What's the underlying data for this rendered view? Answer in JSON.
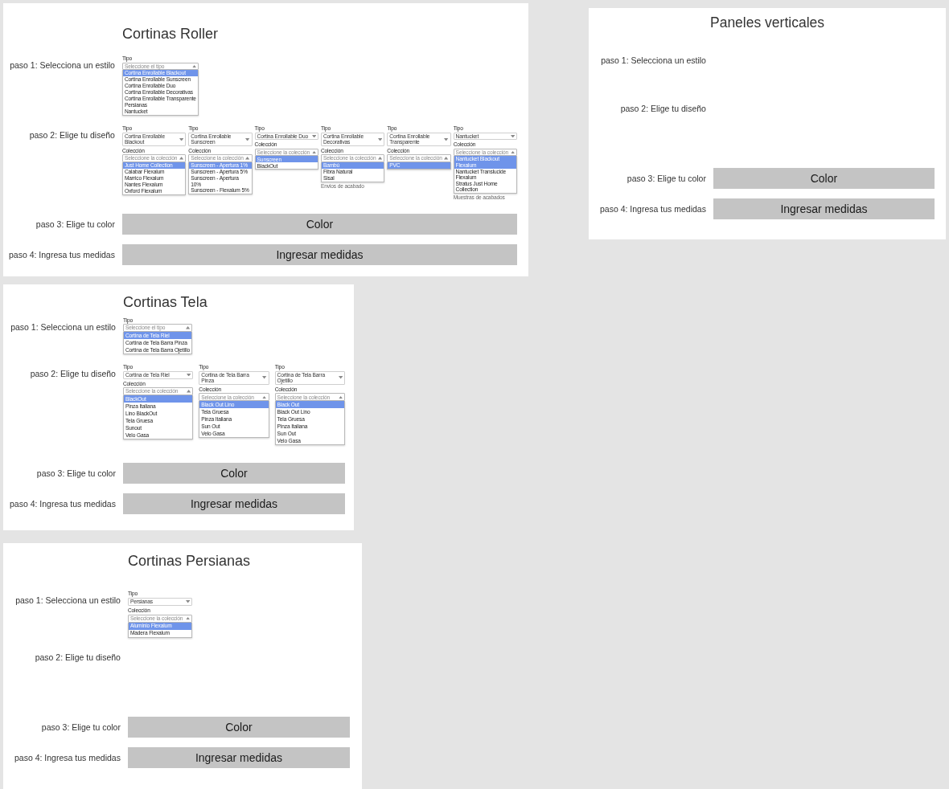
{
  "panels": [
    {
      "title": "Cortinas Roller",
      "steps": [
        {
          "kind": "style",
          "label": "paso 1: Selecciona un estilo",
          "forms": [
            {
              "fields": [
                {
                  "kind": "open",
                  "label": "Tipo",
                  "placeholder": "Seleccione el tipo",
                  "options": [
                    {
                      "text": "Cortina Enrollable Blackout",
                      "selected": true
                    },
                    {
                      "text": "Cortina Enrollable Sunscreen",
                      "selected": false
                    },
                    {
                      "text": "Cortina Enrollable Duo",
                      "selected": false
                    },
                    {
                      "text": "Cortina Enrollable Decorativas",
                      "selected": false
                    },
                    {
                      "text": "Cortina Enrollable Transparente",
                      "selected": false
                    },
                    {
                      "text": "Persianas",
                      "selected": false
                    },
                    {
                      "text": "Nantucket",
                      "selected": false
                    }
                  ]
                }
              ]
            }
          ]
        },
        {
          "kind": "design",
          "label": "paso 2: Elige tu diseño",
          "forms": [
            {
              "fields": [
                {
                  "kind": "select",
                  "label": "Tipo",
                  "value": "Cortina Enrollable Blackout"
                },
                {
                  "kind": "open",
                  "label": "Colección",
                  "placeholder": "Seleccione la colección",
                  "options": [
                    {
                      "text": "Just Home Collection",
                      "selected": true
                    },
                    {
                      "text": "Calabar Flexalum",
                      "selected": false
                    },
                    {
                      "text": "Marrico Flexalum",
                      "selected": false
                    },
                    {
                      "text": "Nantes Flexalum",
                      "selected": false
                    },
                    {
                      "text": "Oxford Flexalum",
                      "selected": false
                    }
                  ]
                }
              ]
            },
            {
              "fields": [
                {
                  "kind": "select",
                  "label": "Tipo",
                  "value": "Cortina Enrollable Sunscreen"
                },
                {
                  "kind": "open",
                  "label": "Colección",
                  "placeholder": "Seleccione la colección",
                  "options": [
                    {
                      "text": "Sunscreen - Apertura 1%",
                      "selected": true
                    },
                    {
                      "text": "Sunscreen - Apertura 5%",
                      "selected": false
                    },
                    {
                      "text": "Sunscreen - Apertura 10%",
                      "selected": false
                    },
                    {
                      "text": "Sunscreen - Flexalum 5%",
                      "selected": false
                    }
                  ]
                }
              ]
            },
            {
              "fields": [
                {
                  "kind": "select",
                  "label": "Tipo",
                  "value": "Cortina Enrollable Duo"
                },
                {
                  "kind": "open",
                  "label": "Colección",
                  "placeholder": "Seleccione la colección",
                  "options": [
                    {
                      "text": "Sunscreen",
                      "selected": true
                    },
                    {
                      "text": "BlackOut",
                      "selected": false
                    }
                  ]
                }
              ]
            },
            {
              "fields": [
                {
                  "kind": "select",
                  "label": "Tipo",
                  "value": "Cortina Enrollable Decorativas"
                },
                {
                  "kind": "open",
                  "label": "Colección",
                  "placeholder": "Seleccione la colección",
                  "options": [
                    {
                      "text": "Bambú",
                      "selected": true
                    },
                    {
                      "text": "Fibra Natural",
                      "selected": false
                    },
                    {
                      "text": "Sisal",
                      "selected": false
                    }
                  ]
                }
              ],
              "note": "Envios de acabado"
            },
            {
              "fields": [
                {
                  "kind": "select",
                  "label": "Tipo",
                  "value": "Cortina Enrollable Transparente"
                },
                {
                  "kind": "open",
                  "label": "Colección",
                  "placeholder": "Seleccione la colección",
                  "options": [
                    {
                      "text": "PVC",
                      "selected": true
                    }
                  ]
                }
              ]
            },
            {
              "fields": [
                {
                  "kind": "select",
                  "label": "Tipo",
                  "value": "Nantucket"
                },
                {
                  "kind": "open",
                  "label": "Colección",
                  "placeholder": "Seleccione la colección",
                  "options": [
                    {
                      "text": "Nantucket Blackout Flexalum",
                      "selected": true
                    },
                    {
                      "text": "Nantucket Translucide Flexalum",
                      "selected": false
                    },
                    {
                      "text": "Stratus Just Home Collection",
                      "selected": false
                    }
                  ]
                }
              ],
              "note": "Muestras de acabados"
            }
          ]
        },
        {
          "kind": "color",
          "label": "paso 3: Elige tu color",
          "button": "Color"
        },
        {
          "kind": "measures",
          "label": "paso 4: Ingresa tus medidas",
          "button": "Ingresar medidas"
        }
      ]
    },
    {
      "title": "Paneles verticales",
      "steps": [
        {
          "kind": "style",
          "label": "paso 1: Selecciona un estilo"
        },
        {
          "kind": "design",
          "label": "paso 2: Elige tu diseño"
        },
        {
          "kind": "color",
          "label": "paso 3: Elige tu color",
          "button": "Color"
        },
        {
          "kind": "measures",
          "label": "paso 4: Ingresa tus medidas",
          "button": "Ingresar medidas"
        }
      ]
    },
    {
      "title": "Cortinas Tela",
      "steps": [
        {
          "kind": "style",
          "label": "paso 1: Selecciona un estilo",
          "forms": [
            {
              "fields": [
                {
                  "kind": "open",
                  "label": "Tipo",
                  "placeholder": "Seleccione el tipo",
                  "options": [
                    {
                      "text": "Cortina de Tela Riel",
                      "selected": true
                    },
                    {
                      "text": "Cortina de Tela Barra Pinza",
                      "selected": false
                    },
                    {
                      "text": "Cortina de Tela Barra Ojetillo",
                      "selected": false
                    }
                  ]
                }
              ]
            }
          ]
        },
        {
          "kind": "design",
          "label": "paso 2: Elige tu diseño",
          "forms": [
            {
              "fields": [
                {
                  "kind": "select",
                  "label": "Tipo",
                  "value": "Cortina de Tela Riel"
                },
                {
                  "kind": "open",
                  "label": "Colección",
                  "placeholder": "Seleccione la colección",
                  "options": [
                    {
                      "text": "BlackOut",
                      "selected": true
                    },
                    {
                      "text": "Pinza Italiana",
                      "selected": false
                    },
                    {
                      "text": "Lino BlackOut",
                      "selected": false
                    },
                    {
                      "text": "Tela Gruesa",
                      "selected": false
                    },
                    {
                      "text": "Sunout",
                      "selected": false
                    },
                    {
                      "text": "Velo Gasa",
                      "selected": false
                    }
                  ]
                }
              ]
            },
            {
              "fields": [
                {
                  "kind": "select",
                  "label": "Tipo",
                  "value": "Cortina de Tela Barra Pinza"
                },
                {
                  "kind": "open",
                  "label": "Colección",
                  "placeholder": "Seleccione la colección",
                  "options": [
                    {
                      "text": "Black Out Lino",
                      "selected": true
                    },
                    {
                      "text": "Tela Gruesa",
                      "selected": false
                    },
                    {
                      "text": "Pinza Italiana",
                      "selected": false
                    },
                    {
                      "text": "Sun Out",
                      "selected": false
                    },
                    {
                      "text": "Velo Gasa",
                      "selected": false
                    }
                  ]
                }
              ]
            },
            {
              "fields": [
                {
                  "kind": "select",
                  "label": "Tipo",
                  "value": "Cortina de Tela Barra Ojetillo"
                },
                {
                  "kind": "open",
                  "label": "Colección",
                  "placeholder": "Seleccione la colección",
                  "options": [
                    {
                      "text": "Black Out",
                      "selected": true
                    },
                    {
                      "text": "Black Out Lino",
                      "selected": false
                    },
                    {
                      "text": "Tela Gruesa",
                      "selected": false
                    },
                    {
                      "text": "Pinza Italiana",
                      "selected": false
                    },
                    {
                      "text": "Sun Out",
                      "selected": false
                    },
                    {
                      "text": "Velo Gasa",
                      "selected": false
                    }
                  ]
                }
              ]
            }
          ]
        },
        {
          "kind": "color",
          "label": "paso 3: Elige tu color",
          "button": "Color"
        },
        {
          "kind": "measures",
          "label": "paso 4: Ingresa tus medidas",
          "button": "Ingresar medidas"
        }
      ]
    },
    {
      "title": "Cortinas Persianas",
      "steps": [
        {
          "kind": "style",
          "label": "paso 1: Selecciona un estilo",
          "forms": [
            {
              "fields": [
                {
                  "kind": "select",
                  "label": "Tipo",
                  "value": "Persianas"
                },
                {
                  "kind": "open",
                  "label": "Colección",
                  "placeholder": "Seleccione la colección",
                  "options": [
                    {
                      "text": "Aluminio Flexalum",
                      "selected": true
                    },
                    {
                      "text": "Madera Flexalum",
                      "selected": false
                    }
                  ]
                }
              ]
            }
          ]
        },
        {
          "kind": "design",
          "label": "paso 2: Elige tu diseño"
        },
        {
          "kind": "color",
          "label": "paso 3: Elige tu color",
          "button": "Color"
        },
        {
          "kind": "measures",
          "label": "paso 4: Ingresa tus medidas",
          "button": "Ingresar medidas"
        }
      ]
    }
  ]
}
